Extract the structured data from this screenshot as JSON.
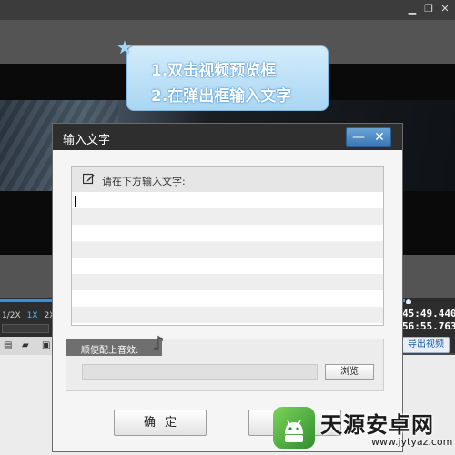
{
  "window": {
    "controls": [
      "minimize-icon",
      "restore-icon",
      "close-icon"
    ]
  },
  "tip": {
    "line1": "1.双击视频预览框",
    "line2": "2.在弹出框输入文字",
    "icon": "star-icon"
  },
  "player": {
    "speeds": [
      "1/2X",
      "1X",
      "2X"
    ],
    "selected_speed": "1X",
    "time_current": "45:49.440",
    "time_total": "56:55.763",
    "export_label": "导出视频",
    "progress_fraction": 0.89
  },
  "dialog": {
    "title": "输入文字",
    "min_symbol": "—",
    "close_symbol": "✕",
    "text_panel_label": "请在下方输入文字:",
    "text_value": "",
    "sound_label": "顺便配上音效:",
    "sound_file_value": "",
    "browse_label": "浏览",
    "ok_label": "确定"
  },
  "watermark": {
    "title": "天源安卓网",
    "url": "www.jytyaz.com"
  },
  "colors": {
    "accent": "#3a8fd8",
    "dialog_title_bg": "#2e2e2e",
    "tip_bg": "#a9d6f3"
  }
}
